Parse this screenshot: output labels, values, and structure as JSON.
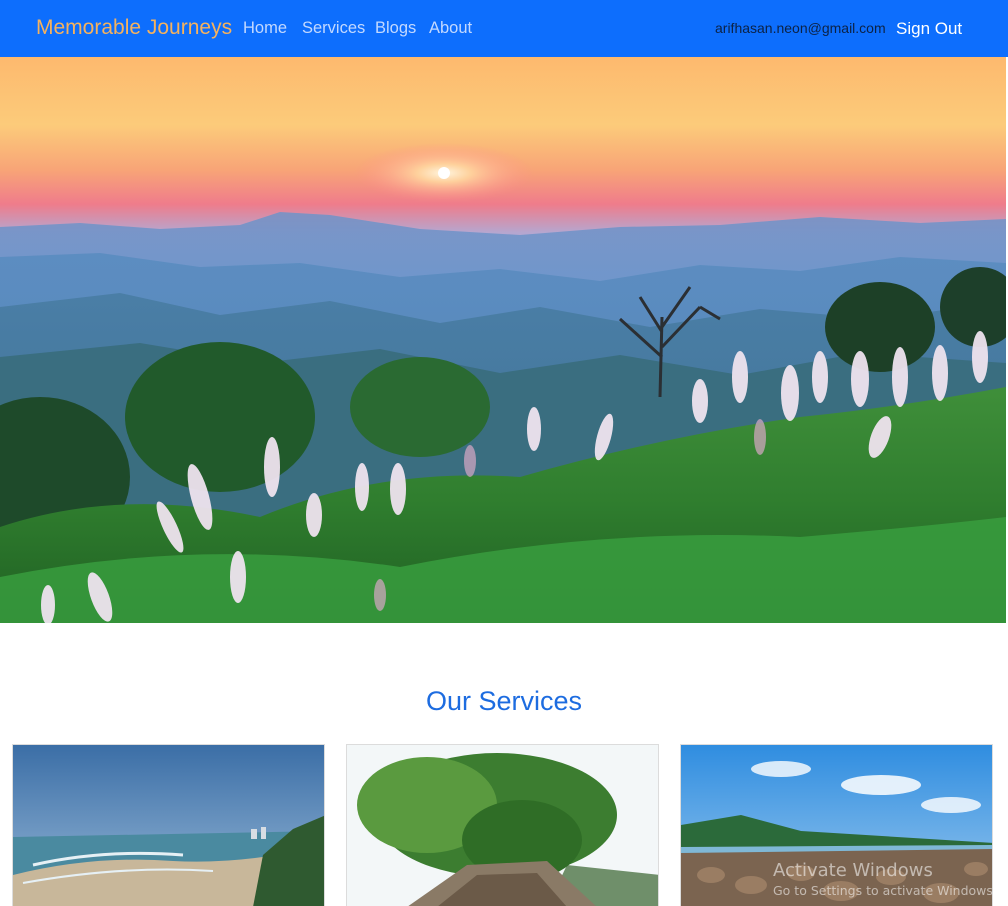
{
  "navbar": {
    "brand": "Memorable Journeys",
    "links": [
      "Home",
      "Services",
      "Blogs",
      "About"
    ],
    "user_email": "arifhasan.neon@gmail.com",
    "signout_label": "Sign Out"
  },
  "services": {
    "title": "Our Services"
  },
  "watermark": {
    "title": "Activate Windows",
    "subtitle": "Go to Settings to activate Windows."
  },
  "colors": {
    "navbar_bg": "#0d6efd",
    "brand": "#f5b25e",
    "nav_link": "#c3d9ff",
    "section_title": "#1d6ce0"
  }
}
